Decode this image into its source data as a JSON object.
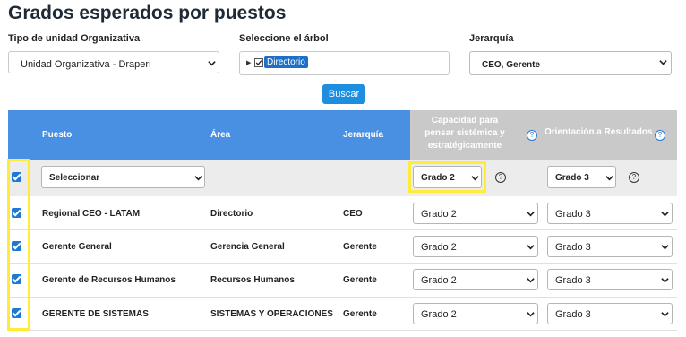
{
  "title": "Grados esperados por puestos",
  "filters": {
    "tipo_label": "Tipo de unidad Organizativa",
    "tipo_value": "Unidad Organizativa - Draperi",
    "arbol_label": "Seleccione el árbol",
    "arbol_node": "Directorio",
    "jerarquia_label": "Jerarquía",
    "jerarquia_value": "CEO, Gerente"
  },
  "buscar_label": "Buscar",
  "table": {
    "headers": {
      "puesto": "Puesto",
      "area": "Área",
      "jerarquia": "Jerarquía",
      "capacidad": "Capacidad para pensar sistémica y estratégicamente",
      "orientacion": "Orientación a Resultados"
    },
    "help_symbol": "?",
    "filter": {
      "puesto_select": "Seleccionar",
      "capacidad": "Grado 2",
      "orientacion": "Grado 3"
    },
    "rows": [
      {
        "puesto": "Regional CEO - LATAM",
        "area": "Directorio",
        "jerarquia": "CEO",
        "capacidad": "Grado 2",
        "orientacion": "Grado 3"
      },
      {
        "puesto": "Gerente General",
        "area": "Gerencia General",
        "jerarquia": "Gerente",
        "capacidad": "Grado 2",
        "orientacion": "Grado 3"
      },
      {
        "puesto": "Gerente de Recursos Humanos",
        "area": "Recursos Humanos",
        "jerarquia": "Gerente",
        "capacidad": "Grado 2",
        "orientacion": "Grado 3"
      },
      {
        "puesto": "GERENTE DE SISTEMAS",
        "area": "SISTEMAS Y OPERACIONES",
        "jerarquia": "Gerente",
        "capacidad": "Grado 2",
        "orientacion": "Grado 3"
      }
    ]
  },
  "colors": {
    "header_blue": "#4a90e2",
    "header_gray": "#c9c9c9",
    "button": "#1e8fe0",
    "checkbox": "#1e78d8",
    "highlight": "#ffeb3b"
  }
}
